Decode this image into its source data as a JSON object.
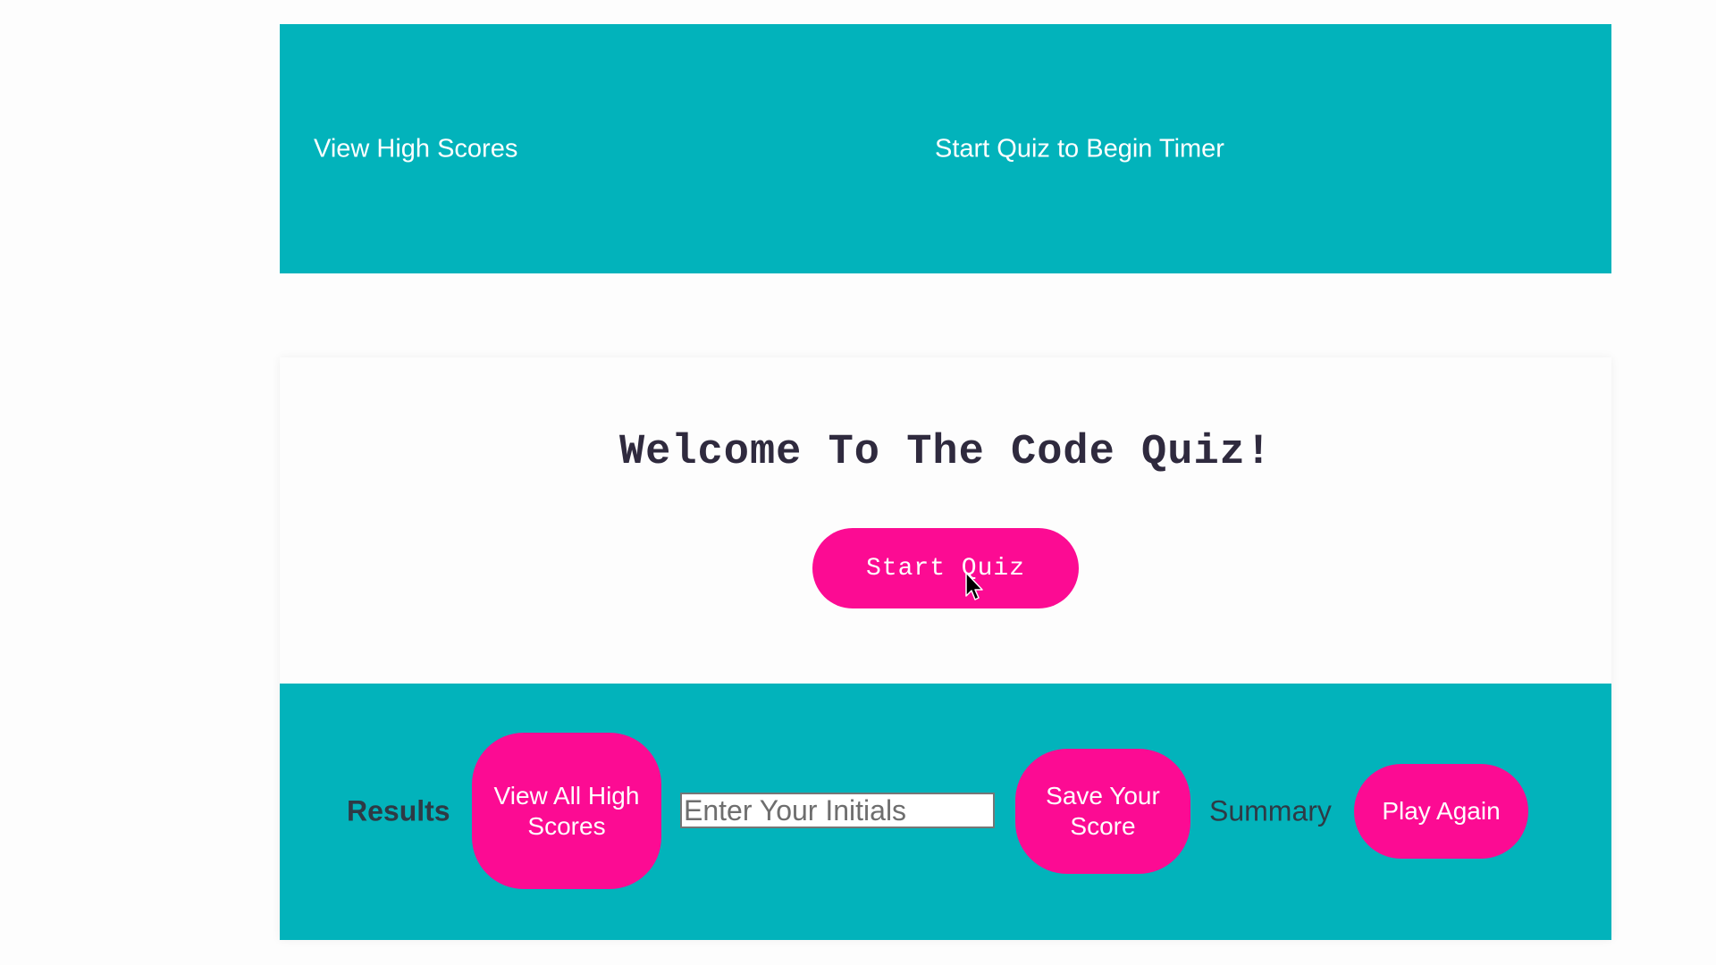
{
  "header": {
    "high_scores_link": "View High Scores",
    "timer_text": "Start Quiz to Begin Timer"
  },
  "quiz": {
    "title": "Welcome To The Code Quiz!",
    "start_button": "Start Quiz"
  },
  "results": {
    "label": "Results",
    "view_all_button": "View All High Scores",
    "initials_placeholder": "Enter Your Initials",
    "save_button": "Save Your Score",
    "summary_label": "Summary",
    "play_again_button": "Play Again"
  },
  "colors": {
    "teal": "#02b3bb",
    "pink": "#fc0b93",
    "dark_text": "#2f2a3e",
    "background": "#fdfdfd"
  },
  "icons": {
    "cursor": "mouse-pointer-icon"
  }
}
